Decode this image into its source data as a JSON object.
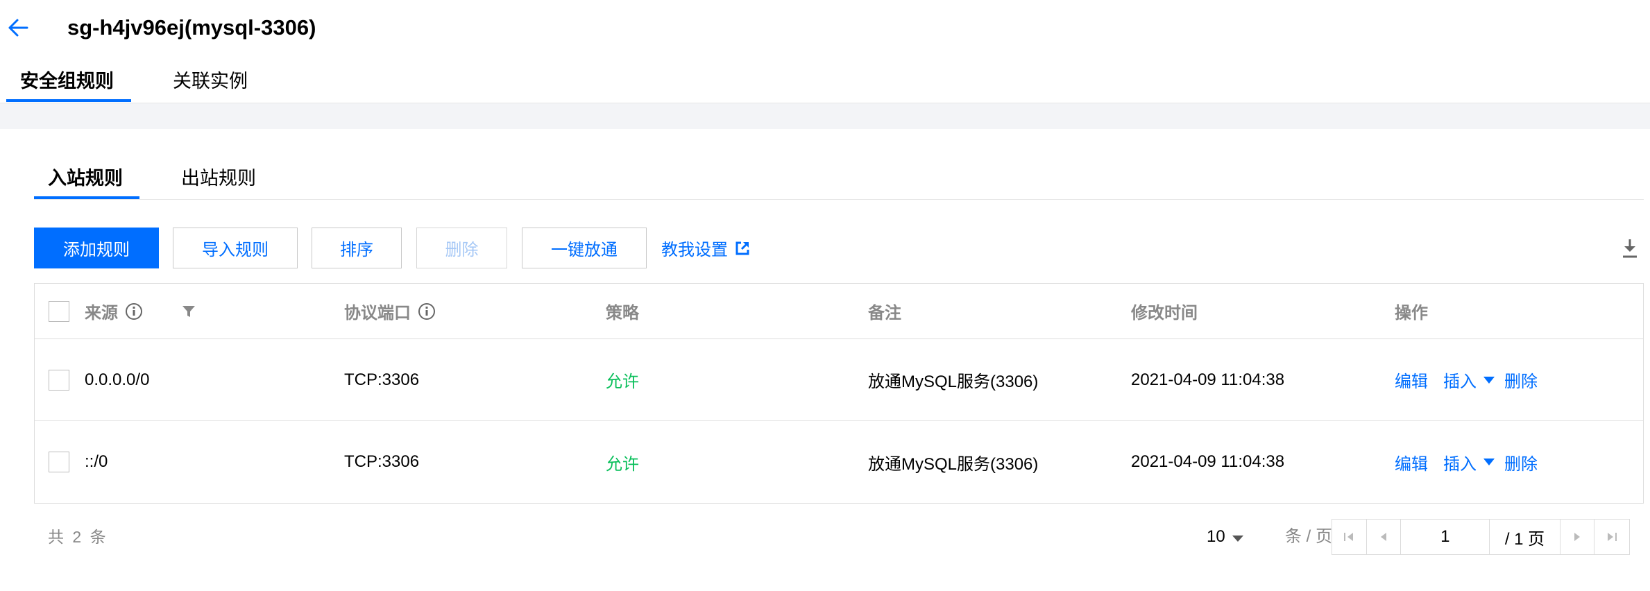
{
  "header": {
    "title": "sg-h4jv96ej(mysql-3306)",
    "tabs": [
      {
        "label": "安全组规则",
        "active": true
      },
      {
        "label": "关联实例",
        "active": false
      }
    ]
  },
  "rules": {
    "tabs": [
      {
        "label": "入站规则",
        "active": true
      },
      {
        "label": "出站规则",
        "active": false
      }
    ],
    "toolbar": {
      "add": "添加规则",
      "import": "导入规则",
      "sort": "排序",
      "delete": "删除",
      "allow_all": "一键放通",
      "help": "教我设置"
    },
    "table": {
      "columns": {
        "source": "来源",
        "protocol_port": "协议端口",
        "policy": "策略",
        "remark": "备注",
        "modified": "修改时间",
        "actions": "操作"
      },
      "rows": [
        {
          "source": "0.0.0.0/0",
          "protocol_port": "TCP:3306",
          "policy": "允许",
          "remark": "放通MySQL服务(3306)",
          "modified": "2021-04-09 11:04:38"
        },
        {
          "source": "::/0",
          "protocol_port": "TCP:3306",
          "policy": "允许",
          "remark": "放通MySQL服务(3306)",
          "modified": "2021-04-09 11:04:38"
        }
      ],
      "row_actions": {
        "edit": "编辑",
        "insert": "插入",
        "delete": "删除"
      }
    },
    "pagination": {
      "total": "共 2 条",
      "page_size": "10",
      "per_page": "条 / 页",
      "current_page": "1",
      "total_pages": "/ 1 页"
    }
  },
  "colors": {
    "accent": "#006eff",
    "allow": "#0abf5b",
    "muted": "#888888"
  }
}
